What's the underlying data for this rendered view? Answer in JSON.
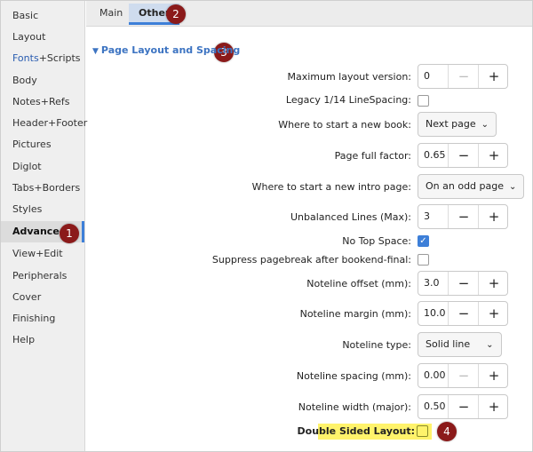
{
  "sidebar": {
    "items": [
      {
        "label": "Basic"
      },
      {
        "label": "Layout"
      },
      {
        "label": "Fonts+Scripts",
        "prefix": "Fonts",
        "suffix": "+Scripts"
      },
      {
        "label": "Body"
      },
      {
        "label": "Notes+Refs"
      },
      {
        "label": "Header+Footer"
      },
      {
        "label": "Pictures"
      },
      {
        "label": "Diglot"
      },
      {
        "label": "Tabs+Borders"
      },
      {
        "label": "Styles"
      },
      {
        "label": "Advanced",
        "active": true
      },
      {
        "label": "View+Edit"
      },
      {
        "label": "Peripherals"
      },
      {
        "label": "Cover"
      },
      {
        "label": "Finishing"
      },
      {
        "label": "Help"
      }
    ]
  },
  "tabs": [
    {
      "label": "Main"
    },
    {
      "label": "Other",
      "active": true
    }
  ],
  "callouts": [
    "1",
    "2",
    "3",
    "4"
  ],
  "section": {
    "title": "Page Layout and Spacing",
    "icon": "chevron-down-icon"
  },
  "fields": {
    "max_layout_version": {
      "label": "Maximum layout version:",
      "value": "0"
    },
    "legacy_linespacing": {
      "label": "Legacy 1/14 LineSpacing:",
      "checked": false
    },
    "start_new_book": {
      "label": "Where to start a new book:",
      "value": "Next page"
    },
    "page_full_factor": {
      "label": "Page full factor:",
      "value": "0.65"
    },
    "start_intro_page": {
      "label": "Where to start a new intro page:",
      "value": "On an odd page"
    },
    "unbalanced_lines": {
      "label": "Unbalanced Lines (Max):",
      "value": "3"
    },
    "no_top_space": {
      "label": "No Top Space:",
      "checked": true
    },
    "suppress_pagebreak": {
      "label": "Suppress pagebreak after bookend-final:",
      "checked": false
    },
    "noteline_offset": {
      "label": "Noteline offset (mm):",
      "value": "3.0"
    },
    "noteline_margin": {
      "label": "Noteline margin (mm):",
      "value": "10.0"
    },
    "noteline_type": {
      "label": "Noteline type:",
      "value": "Solid line"
    },
    "noteline_spacing": {
      "label": "Noteline spacing (mm):",
      "value": "0.00"
    },
    "noteline_width": {
      "label": "Noteline width (major):",
      "value": "0.50"
    },
    "double_sided": {
      "label": "Double Sided Layout:",
      "checked": false
    }
  },
  "colors": {
    "accent": "#3d7fd8",
    "callout": "#8b1a1a",
    "highlight": "#fff36b"
  }
}
